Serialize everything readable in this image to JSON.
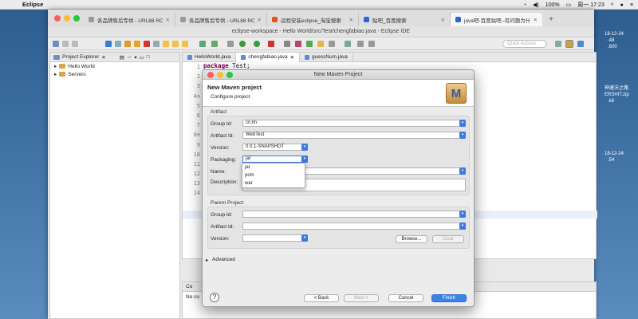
{
  "menubar": {
    "app": "Eclipse",
    "battery": "100%",
    "clock": "周一 17:23"
  },
  "browser": {
    "tabs": [
      {
        "label": "各品牌售后专供 - URL88 ROM"
      },
      {
        "label": "各品牌售后专供 - URL88 ROM"
      },
      {
        "label": "远程安装eclipse_淘宝搜索"
      },
      {
        "label": "贴吧_百度搜索"
      },
      {
        "label": "java吧-百度贴吧--有问题为什么"
      }
    ]
  },
  "eclipse": {
    "title": "eclipse-workspace - Hello World/src/Test/chengfabiao.java - Eclipse IDE",
    "quick_access": "Quick Access",
    "project_explorer": {
      "title": "Project Explorer",
      "items": [
        "Hello World",
        "Servers"
      ]
    },
    "editor_tabs": [
      "HelloWorld.java",
      "chengfabiao.java",
      "guessNum.java"
    ],
    "line_numbers": [
      "1",
      "2",
      "3",
      "4⊖",
      "5",
      "6",
      "7",
      "8⊖",
      "9",
      "10",
      "11",
      "12",
      "13",
      "14"
    ],
    "code_first": "package Test;",
    "console": {
      "tab": "Co",
      "text": "No co"
    }
  },
  "desktop": {
    "labels": [
      "18-12-24",
      ".48",
      ",600",
      "神速沃之路",
      "ERSHIT.zip",
      ".k8",
      "18-12-24",
      ".54"
    ]
  },
  "dialog": {
    "window_title": "New Maven Project",
    "heading": "New Maven project",
    "subheading": "Configure project",
    "logo": "M",
    "artifact_section": "Artifact",
    "group_id_label": "Group Id:",
    "group_id": "cn.lin",
    "artifact_id_label": "Artifact Id:",
    "artifact_id": "WebTest",
    "version_label": "Version:",
    "version": "0.0.1-SNAPSHOT",
    "packaging_label": "Packaging:",
    "packaging": "jar",
    "packaging_options": [
      "jar",
      "pom",
      "war"
    ],
    "name_label": "Name:",
    "description_label": "Description:",
    "parent_section": "Parent Project",
    "p_group_label": "Group Id:",
    "p_artifact_label": "Artifact Id:",
    "p_version_label": "Version:",
    "browse": "Browse...",
    "clear": "Clear",
    "advanced": "Advanced",
    "help": "?",
    "back": "< Back",
    "next": "Next >",
    "cancel": "Cancel",
    "finish": "Finish"
  }
}
